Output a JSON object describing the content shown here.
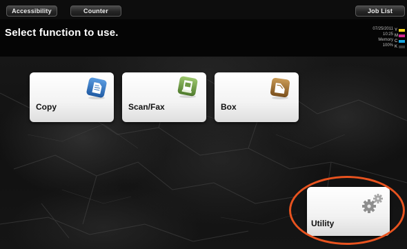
{
  "topbar": {
    "accessibility_label": "Accessibility",
    "counter_label": "Counter",
    "job_list_label": "Job List"
  },
  "header": {
    "title": "Select function to use."
  },
  "status": {
    "date": "07/25/2011",
    "time": "10:25",
    "memory_label": "Memory",
    "memory_value": "100%"
  },
  "toner": [
    {
      "label": "Y",
      "color": "#f2d21b"
    },
    {
      "label": "M",
      "color": "#d4248f"
    },
    {
      "label": "C",
      "color": "#1aa7e0"
    },
    {
      "label": "K",
      "color": "#3a3a3a"
    }
  ],
  "functions": [
    {
      "label": "Copy",
      "icon": "copy-icon",
      "accent": "#2e6fb8"
    },
    {
      "label": "Scan/Fax",
      "icon": "scan-fax-icon",
      "accent": "#6f9a45"
    },
    {
      "label": "Box",
      "icon": "box-icon",
      "accent": "#9a6a2a"
    }
  ],
  "utility": {
    "label": "Utility",
    "icon": "gear-icon",
    "highlight_color": "#e8531f"
  }
}
